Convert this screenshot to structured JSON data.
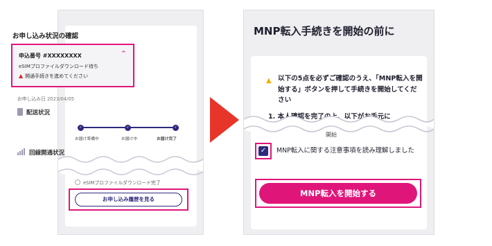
{
  "left": {
    "section_title": "お申し込み状況の確認",
    "application_number": "申込番号 #XXXXXXXX",
    "status": "eSIMプロファイルダウンロード待ち",
    "warning": "開通手続きを進めてください",
    "applied_date": "お申し込み日 2023/04/05",
    "delivery_section": "配送状況",
    "delivery_steps": [
      "お届け準備中",
      "お届け中",
      "お届け完了"
    ],
    "line_section": "回線開通状況",
    "esim_status": "eSIMプロファイルダウンロード完了",
    "history_button": "お申し込み履歴を見る"
  },
  "right": {
    "title": "MNP転入手続きを開始の前に",
    "notice": "以下の5点を必ずご確認のうえ、「MNP転入を開始する」ボタンを押して手続きを開始してください",
    "partial_text": "1. 本人確認を完了の上、以下がお手元に",
    "start_label": "開始",
    "checkbox_label": "MNP転入に関する注意事項を読み理解しました",
    "start_button": "MNP転入を開始する"
  },
  "colors": {
    "highlight": "#e0157a",
    "primary": "#2e2a7c",
    "arrow": "#e8352a",
    "warning_yellow": "#f0b000",
    "warning_red": "#d8262a"
  }
}
